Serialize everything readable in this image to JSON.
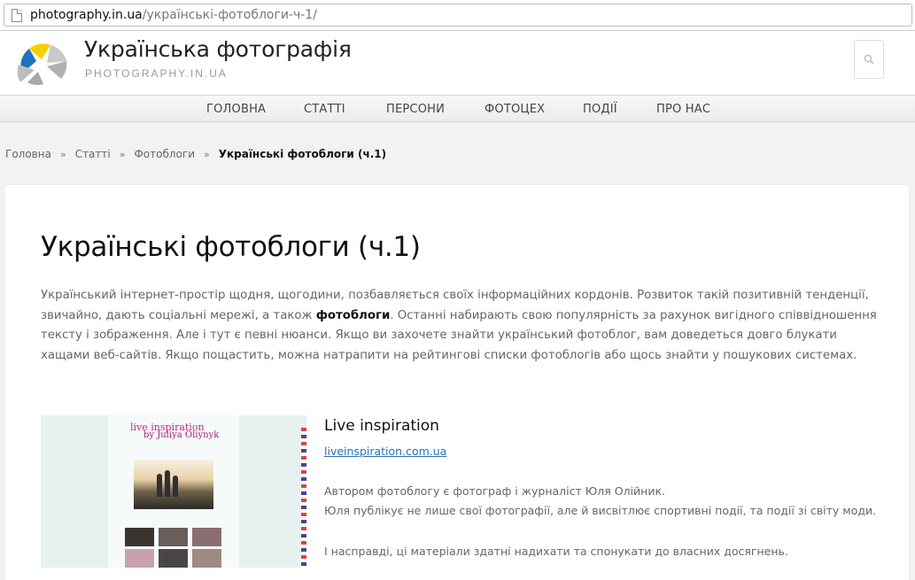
{
  "browser": {
    "url_domain": "photography.in.ua",
    "url_path": "/українські-фотоблоги-ч-1/"
  },
  "header": {
    "site_title": "Українська фотографія",
    "tagline": "PHOTOGRAPHY.IN.UA",
    "search_icon": "search-icon"
  },
  "nav": {
    "items": [
      {
        "label": "ГОЛОВНА"
      },
      {
        "label": "СТАТТІ"
      },
      {
        "label": "ПЕРСОНИ"
      },
      {
        "label": "ФОТОЦЕХ"
      },
      {
        "label": "ПОДІЇ"
      },
      {
        "label": "ПРО НАС"
      }
    ]
  },
  "breadcrumb": {
    "items": [
      "Головна",
      "Статті",
      "Фотоблоги"
    ],
    "separator": "»",
    "current": "Українські фотоблоги (ч.1)"
  },
  "article": {
    "title": "Українські фотоблоги (ч.1)",
    "intro_before": "Український інтернет-простір щодня, щогодини, позбавляється своїх інформаційних кордонів. Розвиток такій позитивній тенденції, звичайно, дають соціальні мережі, а також ",
    "intro_bold": "фотоблоги",
    "intro_after": ". Останні набирають свою популярність за рахунок вигідного співвідношення тексту і зображення. Але і тут є певні нюанси. Якщо ви захочете знайти український фотоблог, вам доведеться довго блукати хащами веб-сайтів. Якщо пощастить, можна натрапити на рейтингові списки фотоблогів або щось знайти у пошукових системах."
  },
  "blog_item": {
    "title": "Live inspiration",
    "link": "liveinspiration.com.ua",
    "line1": "Автором фотоблогу є фотограф і журналіст Юля Олійник.",
    "line2": "Юля публікує не лише свої фотографії, але й висвітлює спортивні події, та події зі світу моди.",
    "line3": "І насправді, ці матеріали здатні надихати та спонукати до власних досягнень.",
    "thumb_title": "live inspiration",
    "thumb_subtitle": "by Juliya Oliynyk"
  },
  "colors": {
    "link": "#2a6fb3",
    "logo_yellow": "#f5d100",
    "logo_blue": "#1e73be",
    "logo_gray": "#b7b7b7"
  }
}
